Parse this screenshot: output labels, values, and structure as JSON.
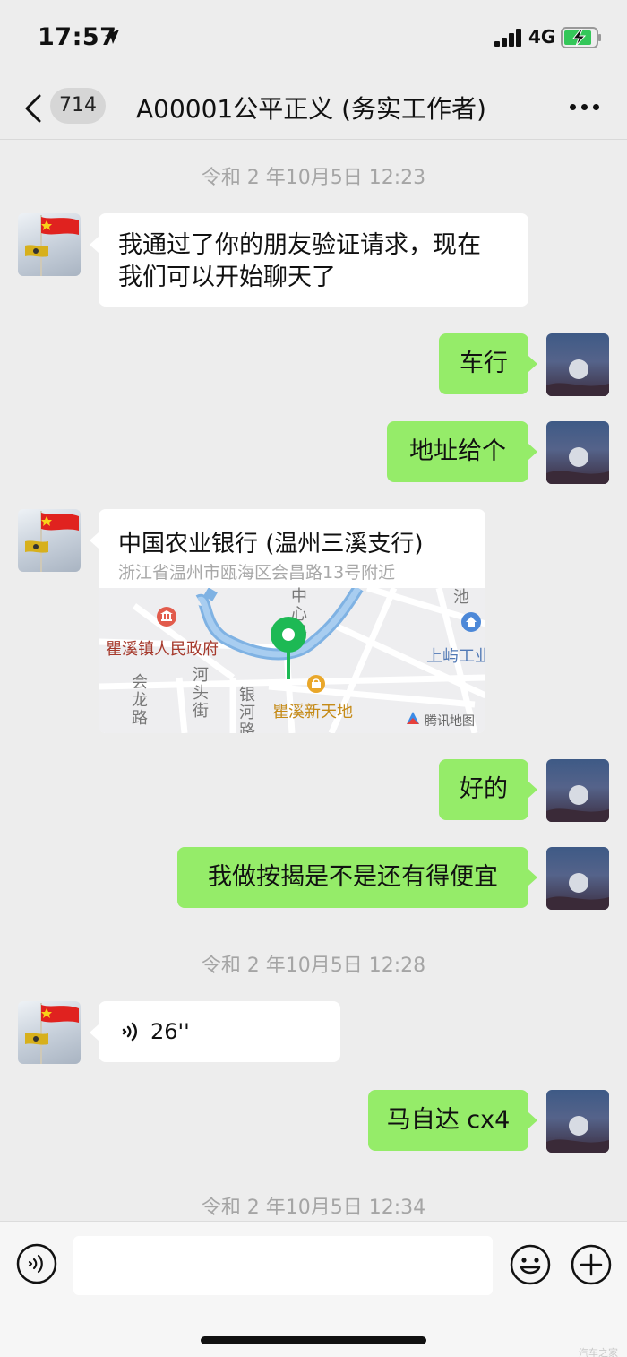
{
  "status_bar": {
    "time": "17:57",
    "network": "4G"
  },
  "nav": {
    "unread_count": "714",
    "title": "A00001公平正义 (务实工作者)"
  },
  "timestamps": {
    "t1": "令和 2 年10月5日 12:23",
    "t2": "令和 2 年10月5日 12:28",
    "t3": "令和 2 年10月5日 12:34"
  },
  "messages": {
    "m1_line1": "我通过了你的朋友验证请求，现在",
    "m1_line2": "我们可以开始聊天了",
    "m2": "车行",
    "m3": "地址给个",
    "m5": "好的",
    "m6": "我做按揭是不是还有得便宜",
    "m8": "马自达 cx4"
  },
  "location": {
    "name": "中国农业银行 (温州三溪支行)",
    "address": "浙江省温州市瓯海区会昌路13号附近",
    "map_labels": {
      "gov": "瞿溪镇人民政府",
      "tiandi": "瞿溪新天地",
      "shangyu": "上屿工业",
      "zhongxin_road": "中心路",
      "chi": "池",
      "huilong_road": "会龙路",
      "hetou_street": "河头街",
      "yinhe_road": "银河路",
      "brand": "腾讯地图"
    }
  },
  "voice": {
    "duration": "26''"
  },
  "input": {
    "placeholder": ""
  },
  "watermark": "汽车之家",
  "colors": {
    "outgoing_bubble": "#95ec69",
    "incoming_bubble": "#ffffff",
    "background": "#ededed",
    "map_pin": "#1db954"
  },
  "icons": [
    "location-arrow-icon",
    "signal-icon",
    "battery-charging-icon",
    "back-chevron-icon",
    "more-icon",
    "map-pin-icon",
    "voice-wave-icon",
    "voice-toggle-icon",
    "emoji-icon",
    "plus-icon"
  ]
}
